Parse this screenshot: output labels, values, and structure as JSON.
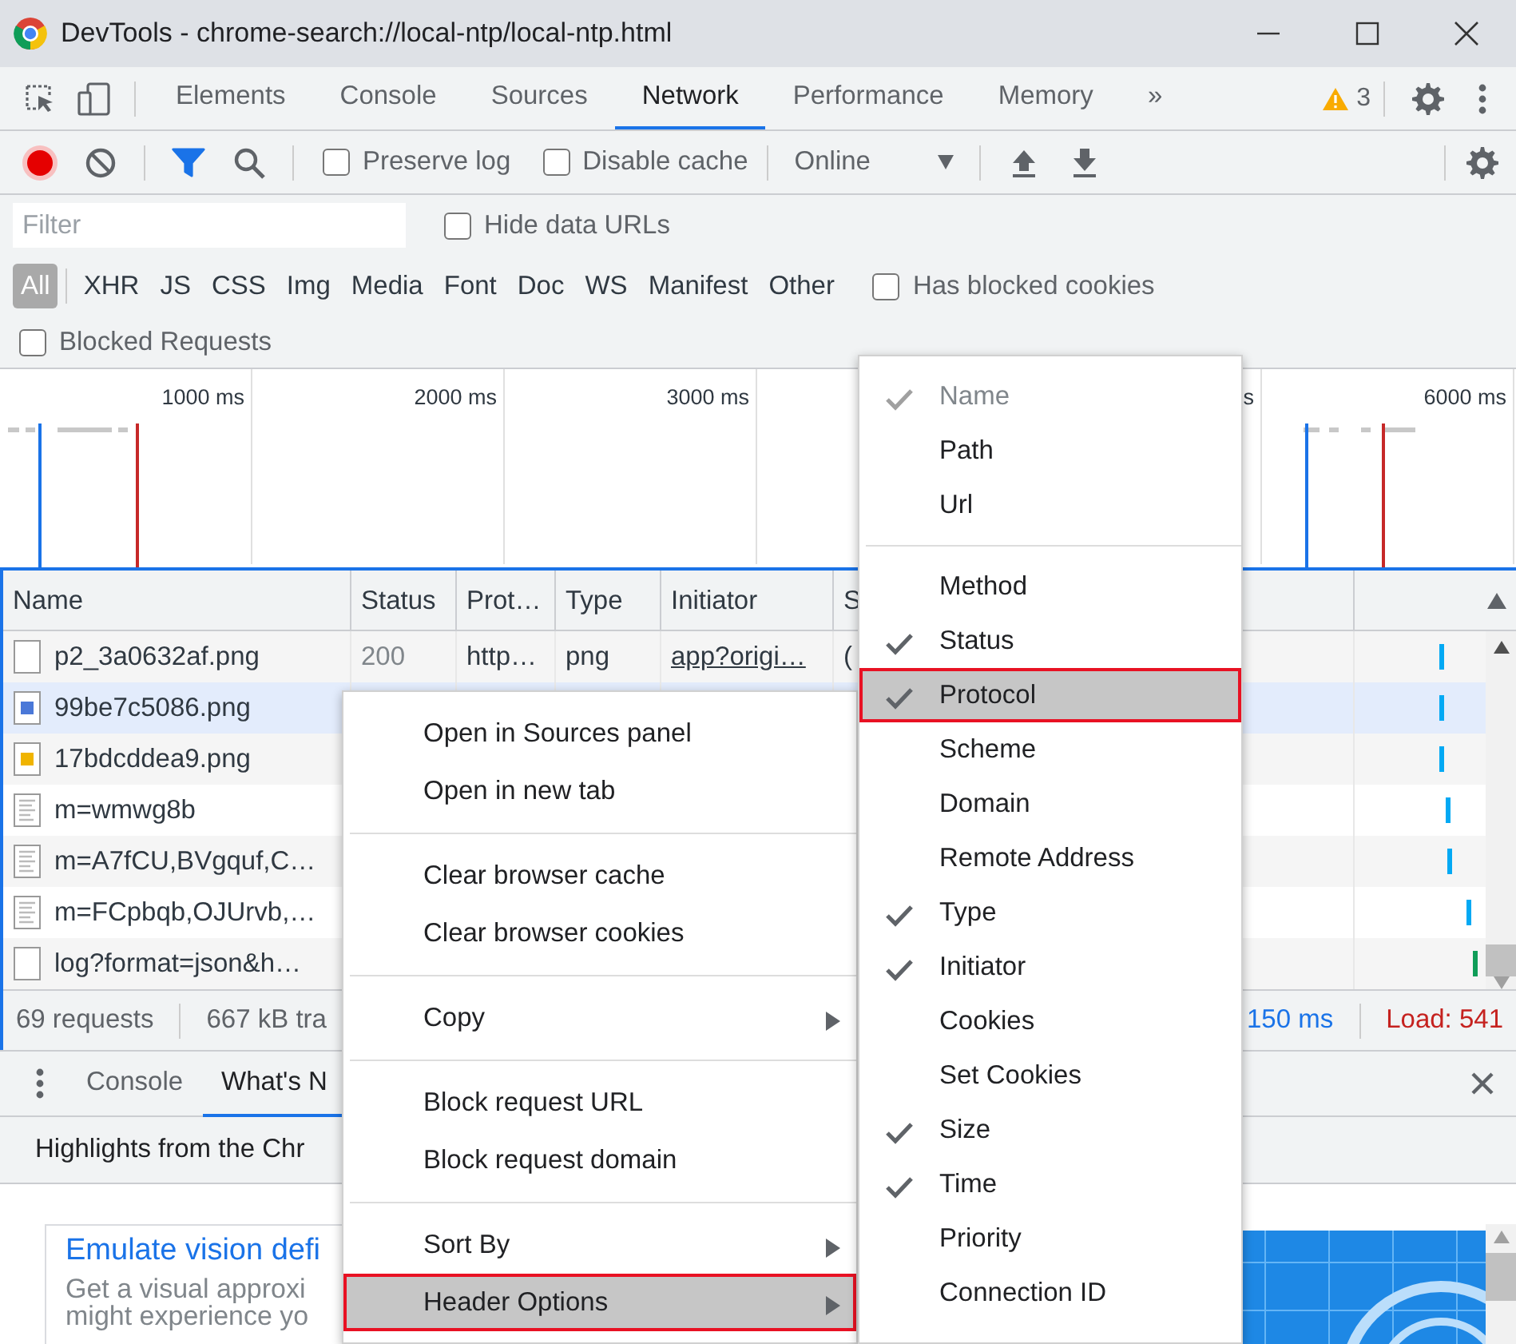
{
  "window": {
    "title": "DevTools - chrome-search://local-ntp/local-ntp.html"
  },
  "panel_tabs": [
    {
      "label": "Elements",
      "selected": false
    },
    {
      "label": "Console",
      "selected": false
    },
    {
      "label": "Sources",
      "selected": false
    },
    {
      "label": "Network",
      "selected": true
    },
    {
      "label": "Performance",
      "selected": false
    },
    {
      "label": "Memory",
      "selected": false
    }
  ],
  "more_tabs": "»",
  "warnings": {
    "count": "3"
  },
  "toolbar": {
    "recording": true,
    "filter_active": true,
    "preserve_log": {
      "label": "Preserve log",
      "checked": false
    },
    "disable_cache": {
      "label": "Disable cache",
      "checked": false
    },
    "throttling": "Online"
  },
  "filter": {
    "placeholder": "Filter",
    "hide_data_urls": {
      "label": "Hide data URLs",
      "checked": false
    }
  },
  "type_filters": [
    {
      "label": "All",
      "selected": true
    },
    {
      "label": "XHR",
      "selected": false
    },
    {
      "label": "JS",
      "selected": false
    },
    {
      "label": "CSS",
      "selected": false
    },
    {
      "label": "Img",
      "selected": false
    },
    {
      "label": "Media",
      "selected": false
    },
    {
      "label": "Font",
      "selected": false
    },
    {
      "label": "Doc",
      "selected": false
    },
    {
      "label": "WS",
      "selected": false
    },
    {
      "label": "Manifest",
      "selected": false
    },
    {
      "label": "Other",
      "selected": false
    }
  ],
  "has_blocked_cookies": {
    "label": "Has blocked cookies",
    "checked": false
  },
  "blocked_requests": {
    "label": "Blocked Requests",
    "checked": false
  },
  "overview": {
    "ticks": [
      "1000 ms",
      "2000 ms",
      "3000 ms"
    ],
    "ticks_right": [
      "s",
      "6000 ms"
    ]
  },
  "table": {
    "columns": [
      "Name",
      "Status",
      "Prot…",
      "Type",
      "Initiator",
      "S"
    ],
    "rows": [
      {
        "kind": "blank",
        "name": "p2_3a0632af.png",
        "status": "200",
        "protocol": "http…",
        "type": "png",
        "initiator": "app?origi…",
        "column_6": "(",
        "selected": false
      },
      {
        "kind": "image-blue",
        "name": "99be7c5086.png",
        "selected": true
      },
      {
        "kind": "image-yellow",
        "name": "17bdcddea9.png",
        "selected": false
      },
      {
        "kind": "script",
        "name": "m=wmwg8b",
        "selected": false
      },
      {
        "kind": "script",
        "name": "m=A7fCU,BVgquf,C…",
        "selected": false
      },
      {
        "kind": "script",
        "name": "m=FCpbqb,OJUrvb,…",
        "selected": false
      },
      {
        "kind": "blank",
        "name": "log?format=json&h…",
        "selected": false
      }
    ]
  },
  "status_bar": {
    "requests": "69 requests",
    "transferred": "667 kB tra",
    "dom_loaded": "150 ms",
    "load": "Load: 541"
  },
  "drawer": {
    "tabs": [
      {
        "label": "Console",
        "selected": false
      },
      {
        "label": "What's N",
        "selected": true
      }
    ],
    "highlights": "Highlights from the Chr",
    "card": {
      "title": "Emulate vision defi",
      "lines": [
        "Get a visual approxi",
        "might experience yo"
      ]
    }
  },
  "context_menu": {
    "groups": [
      [
        {
          "label": "Open in Sources panel",
          "submenu": false,
          "highlighted": false,
          "outlined": false
        },
        {
          "label": "Open in new tab",
          "submenu": false,
          "highlighted": false,
          "outlined": false
        }
      ],
      [
        {
          "label": "Clear browser cache",
          "submenu": false,
          "highlighted": false,
          "outlined": false
        },
        {
          "label": "Clear browser cookies",
          "submenu": false,
          "highlighted": false,
          "outlined": false
        }
      ],
      [
        {
          "label": "Copy",
          "submenu": true,
          "highlighted": false,
          "outlined": false
        }
      ],
      [
        {
          "label": "Block request URL",
          "submenu": false,
          "highlighted": false,
          "outlined": false
        },
        {
          "label": "Block request domain",
          "submenu": false,
          "highlighted": false,
          "outlined": false
        }
      ],
      [
        {
          "label": "Sort By",
          "submenu": true,
          "highlighted": false,
          "outlined": false
        },
        {
          "label": "Header Options",
          "submenu": true,
          "highlighted": true,
          "outlined": true
        }
      ]
    ]
  },
  "header_options": {
    "groups": [
      [
        {
          "label": "Name",
          "checked": true,
          "disabled": true,
          "highlighted": false,
          "outlined": false
        },
        {
          "label": "Path",
          "checked": false,
          "disabled": false,
          "highlighted": false,
          "outlined": false
        },
        {
          "label": "Url",
          "checked": false,
          "disabled": false,
          "highlighted": false,
          "outlined": false
        }
      ],
      [
        {
          "label": "Method",
          "checked": false,
          "disabled": false,
          "highlighted": false,
          "outlined": false
        },
        {
          "label": "Status",
          "checked": true,
          "disabled": false,
          "highlighted": false,
          "outlined": false
        },
        {
          "label": "Protocol",
          "checked": true,
          "disabled": false,
          "highlighted": true,
          "outlined": true
        },
        {
          "label": "Scheme",
          "checked": false,
          "disabled": false,
          "highlighted": false,
          "outlined": false
        },
        {
          "label": "Domain",
          "checked": false,
          "disabled": false,
          "highlighted": false,
          "outlined": false
        },
        {
          "label": "Remote Address",
          "checked": false,
          "disabled": false,
          "highlighted": false,
          "outlined": false
        },
        {
          "label": "Type",
          "checked": true,
          "disabled": false,
          "highlighted": false,
          "outlined": false
        },
        {
          "label": "Initiator",
          "checked": true,
          "disabled": false,
          "highlighted": false,
          "outlined": false
        },
        {
          "label": "Cookies",
          "checked": false,
          "disabled": false,
          "highlighted": false,
          "outlined": false
        },
        {
          "label": "Set Cookies",
          "checked": false,
          "disabled": false,
          "highlighted": false,
          "outlined": false
        },
        {
          "label": "Size",
          "checked": true,
          "disabled": false,
          "highlighted": false,
          "outlined": false
        },
        {
          "label": "Time",
          "checked": true,
          "disabled": false,
          "highlighted": false,
          "outlined": false
        },
        {
          "label": "Priority",
          "checked": false,
          "disabled": false,
          "highlighted": false,
          "outlined": false
        },
        {
          "label": "Connection ID",
          "checked": false,
          "disabled": false,
          "highlighted": false,
          "outlined": false
        }
      ]
    ]
  }
}
